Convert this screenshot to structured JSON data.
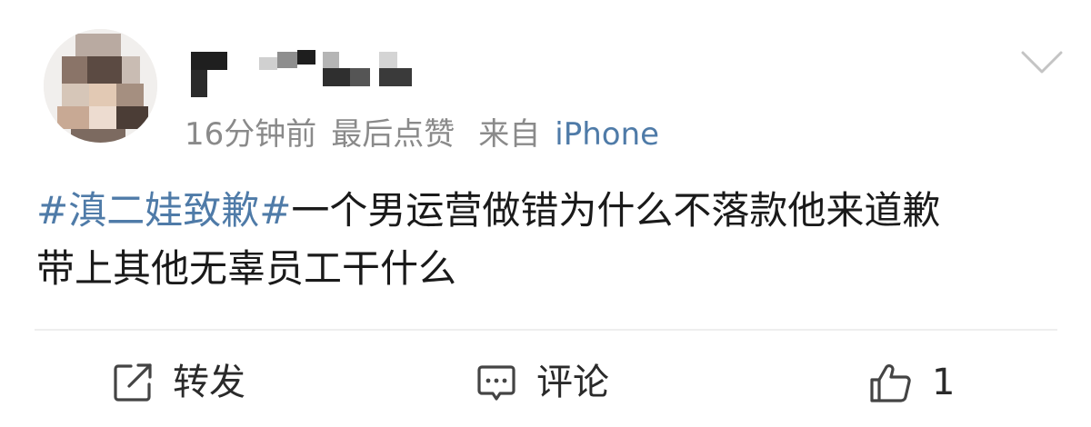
{
  "post": {
    "author": {
      "avatar_icon": "avatar-image",
      "name_obscured": true
    },
    "meta": {
      "time": "16分钟前",
      "activity": "最后点赞",
      "source_prefix": "来自",
      "source": "iPhone"
    },
    "more_icon": "chevron-down-icon",
    "text": {
      "topic": "#滇二娃致歉#",
      "line1_rest": "一个男运营做错为什么不落款他来道歉",
      "line2": "带上其他无辜员工干什么"
    }
  },
  "actions": {
    "forward": {
      "icon": "share-icon",
      "label": "转发"
    },
    "comment": {
      "icon": "comment-icon",
      "label": "评论"
    },
    "like": {
      "icon": "thumbs-up-icon",
      "count": "1"
    }
  },
  "colors": {
    "link": "#4f7ba8",
    "meta": "#8a8a8a",
    "text": "#1a1a1a",
    "divider": "#eeeeee"
  }
}
